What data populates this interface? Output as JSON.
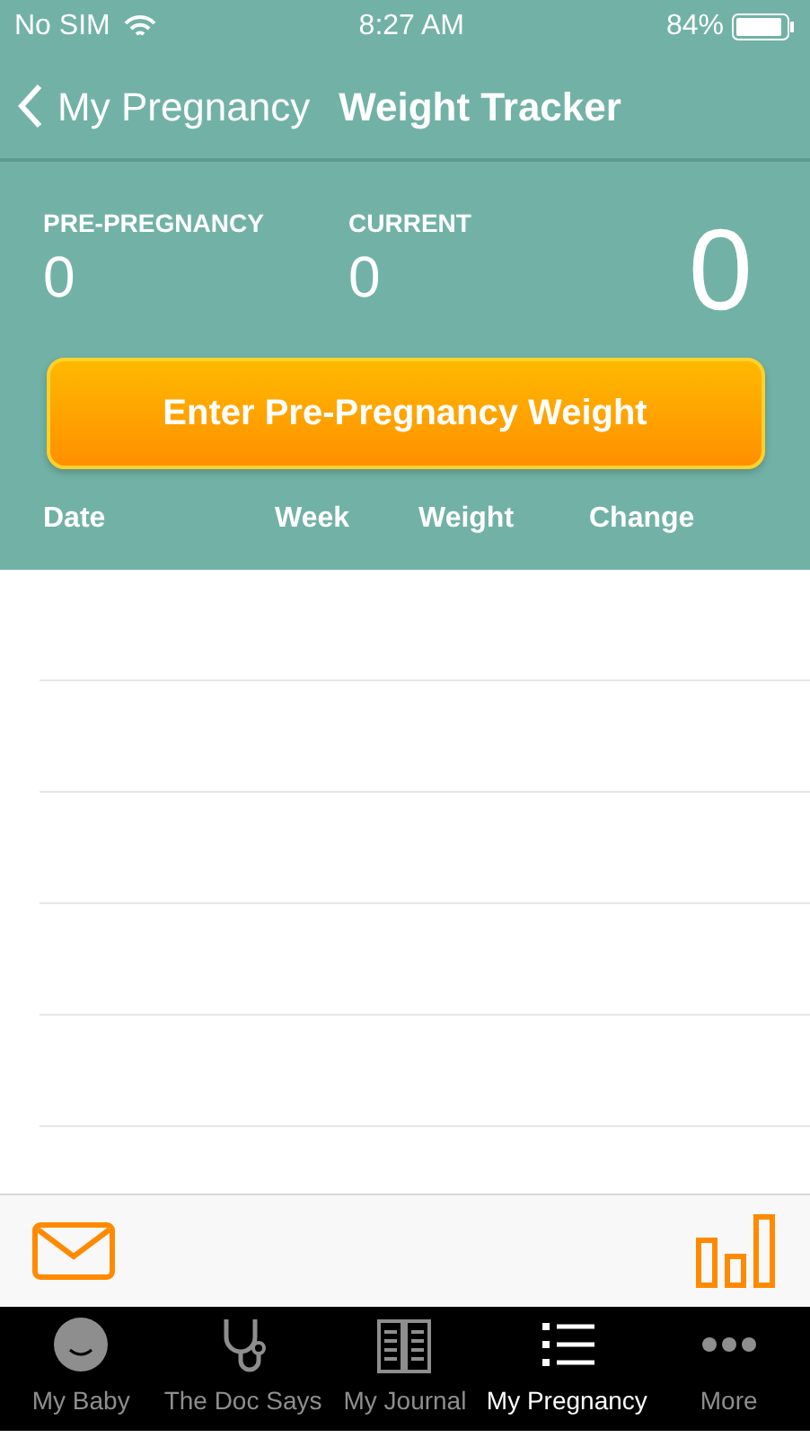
{
  "status_bar": {
    "carrier": "No SIM",
    "time": "8:27 AM",
    "battery": "84%"
  },
  "nav": {
    "back": "My Pregnancy",
    "title": "Weight Tracker"
  },
  "stats": [
    {
      "label": "PRE-PREGNANCY",
      "value": "0"
    },
    {
      "label": "CURRENT",
      "value": "0"
    }
  ],
  "total": "0",
  "action_button": "Enter Pre-Pregnancy Weight",
  "table": {
    "columns": [
      "Date",
      "Week",
      "Weight",
      "Change"
    ]
  },
  "tab_bar": [
    {
      "label": "My Baby",
      "kind": "baby",
      "selected": false
    },
    {
      "label": "The Doc Says",
      "kind": "doc",
      "selected": false
    },
    {
      "label": "My Journal",
      "kind": "journal",
      "selected": false
    },
    {
      "label": "My Pregnancy",
      "kind": "list",
      "selected": true
    },
    {
      "label": "More",
      "kind": "more",
      "selected": false
    }
  ]
}
